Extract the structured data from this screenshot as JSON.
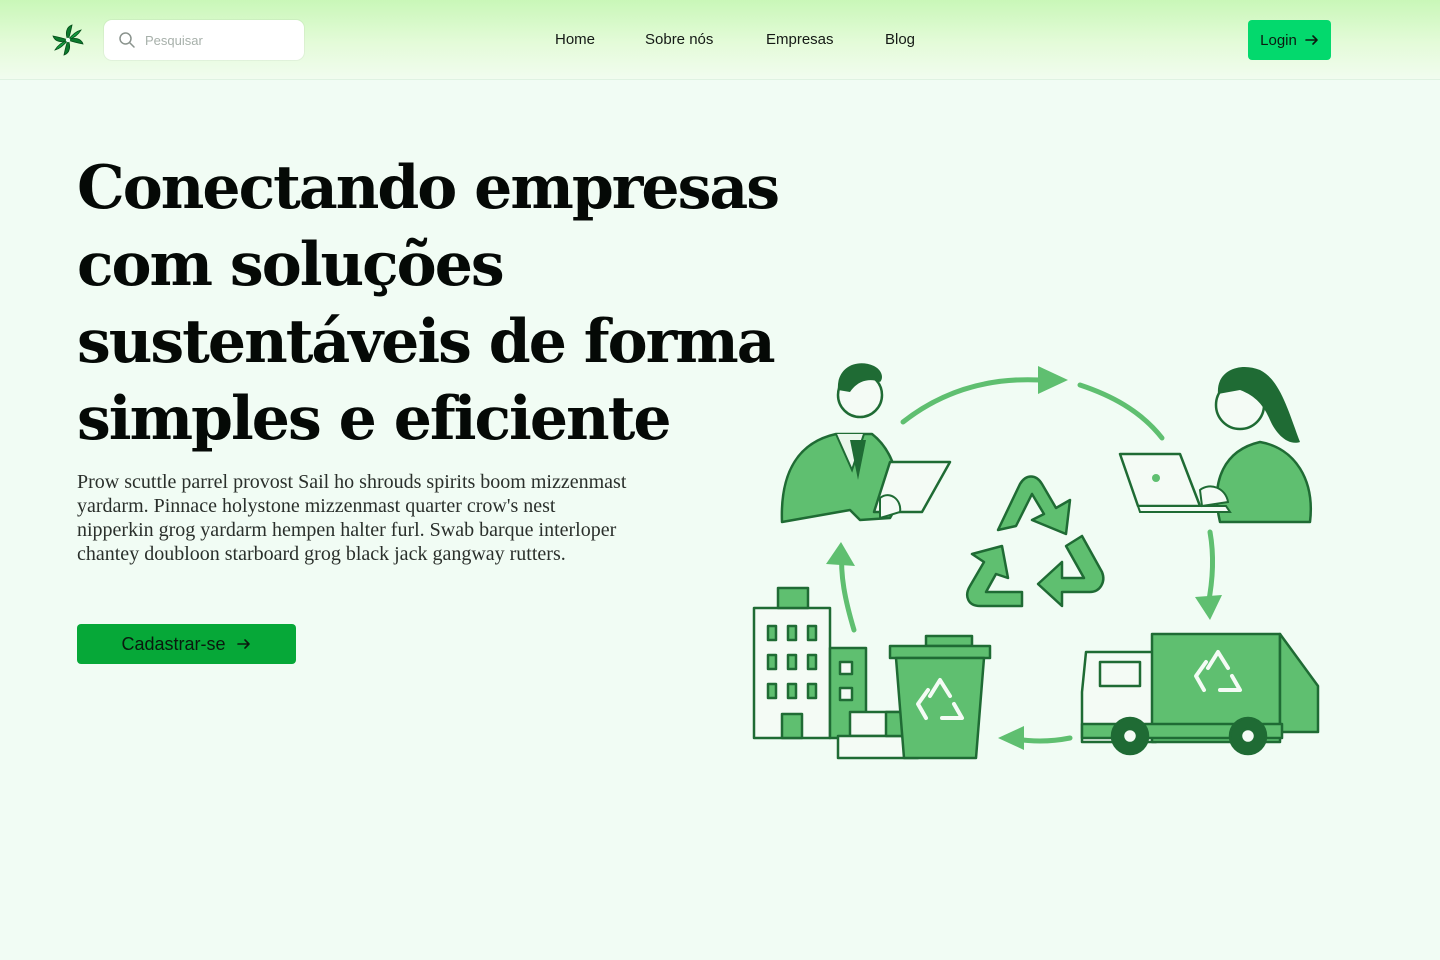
{
  "header": {
    "search": {
      "placeholder": "Pesquisar"
    },
    "nav": [
      {
        "label": "Home"
      },
      {
        "label": "Sobre nós"
      },
      {
        "label": "Empresas"
      },
      {
        "label": "Blog"
      }
    ],
    "login_label": "Login"
  },
  "hero": {
    "title": "Conectando empresas com soluções sustentáveis de forma simples e eficiente",
    "text": "Prow scuttle parrel provost Sail ho shrouds spirits boom mizzenmast  yardarm. Pinnace holystone mizzenmast quarter crow's nest nipperkin grog yardarm hempen halter furl. Swab barque interloper chantey doubloon  starboard grog black jack gangway rutters.",
    "cta_label": "Cadastrar-se"
  },
  "colors": {
    "brand": "#03d96d",
    "cta": "#06a838",
    "illustration_green": "#5fbf70",
    "illustration_dark": "#1f6b34",
    "background": "#f1fcf4"
  },
  "icons": {
    "logo": "pinwheel-leaf-logo",
    "search": "search-icon",
    "arrow": "arrow-right-icon",
    "recycle": "recycle-icon"
  }
}
